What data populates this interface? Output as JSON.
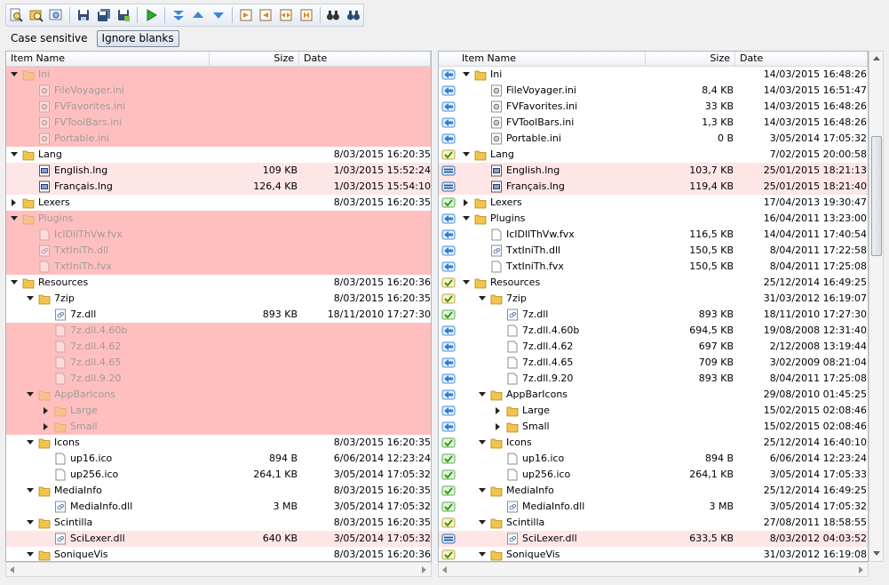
{
  "toolbar": {
    "icons": [
      "search-file-icon",
      "search-folder-icon",
      "find-icon",
      "save-icon",
      "save-all-icon",
      "save-as-icon",
      "run-icon",
      "expand-all-icon",
      "prev-diff-icon",
      "next-diff-icon",
      "copy-right-icon",
      "copy-left-icon",
      "swap-icon",
      "merge-icon",
      "find-binoculars-icon",
      "find-next-binoculars-icon"
    ]
  },
  "options": {
    "case_sensitive": "Case sensitive",
    "ignore_blanks": "Ignore blanks"
  },
  "columns": {
    "name": "Item Name",
    "size": "Size",
    "date": "Date"
  },
  "left": [
    {
      "lvl": 0,
      "tw": "open",
      "type": "folder",
      "name": "Ini",
      "size": "",
      "date": "",
      "bg": "diff",
      "missing": true
    },
    {
      "lvl": 1,
      "type": "ini",
      "name": "FileVoyager.ini",
      "size": "",
      "date": "",
      "bg": "diff",
      "missing": true
    },
    {
      "lvl": 1,
      "type": "ini",
      "name": "FVFavorites.ini",
      "size": "",
      "date": "",
      "bg": "diff",
      "missing": true
    },
    {
      "lvl": 1,
      "type": "ini",
      "name": "FVToolBars.ini",
      "size": "",
      "date": "",
      "bg": "diff",
      "missing": true
    },
    {
      "lvl": 1,
      "type": "ini",
      "name": "Portable.ini",
      "size": "",
      "date": "",
      "bg": "diff",
      "missing": true
    },
    {
      "lvl": 0,
      "tw": "open",
      "type": "folder",
      "name": "Lang",
      "size": "",
      "date": "8/03/2015 16:20:35"
    },
    {
      "lvl": 1,
      "type": "lng",
      "name": "English.lng",
      "size": "109 KB",
      "date": "1/03/2015 15:52:24",
      "bg": "light"
    },
    {
      "lvl": 1,
      "type": "lng",
      "name": "Français.lng",
      "size": "126,4 KB",
      "date": "1/03/2015 15:54:10",
      "bg": "light"
    },
    {
      "lvl": 0,
      "tw": "closed",
      "type": "folder",
      "name": "Lexers",
      "size": "",
      "date": "8/03/2015 16:20:35"
    },
    {
      "lvl": 0,
      "tw": "open",
      "type": "folder",
      "name": "Plugins",
      "size": "",
      "date": "",
      "bg": "diff",
      "missing": true
    },
    {
      "lvl": 1,
      "type": "file",
      "name": "IcIDllThVw.fvx",
      "size": "",
      "date": "",
      "bg": "diff",
      "missing": true
    },
    {
      "lvl": 1,
      "type": "dll",
      "name": "TxtIniTh.dll",
      "size": "",
      "date": "",
      "bg": "diff",
      "missing": true
    },
    {
      "lvl": 1,
      "type": "file",
      "name": "TxtIniTh.fvx",
      "size": "",
      "date": "",
      "bg": "diff",
      "missing": true
    },
    {
      "lvl": 0,
      "tw": "open",
      "type": "folder",
      "name": "Resources",
      "size": "",
      "date": "8/03/2015 16:20:36"
    },
    {
      "lvl": 1,
      "tw": "open",
      "type": "folder",
      "name": "7zip",
      "size": "",
      "date": "8/03/2015 16:20:35"
    },
    {
      "lvl": 2,
      "type": "dll",
      "name": "7z.dll",
      "size": "893 KB",
      "date": "18/11/2010 17:27:30"
    },
    {
      "lvl": 2,
      "type": "file",
      "name": "7z.dll.4.60b",
      "size": "",
      "date": "",
      "bg": "diff",
      "missing": true
    },
    {
      "lvl": 2,
      "type": "file",
      "name": "7z.dll.4.62",
      "size": "",
      "date": "",
      "bg": "diff",
      "missing": true
    },
    {
      "lvl": 2,
      "type": "file",
      "name": "7z.dll.4.65",
      "size": "",
      "date": "",
      "bg": "diff",
      "missing": true
    },
    {
      "lvl": 2,
      "type": "file",
      "name": "7z.dll.9.20",
      "size": "",
      "date": "",
      "bg": "diff",
      "missing": true
    },
    {
      "lvl": 1,
      "tw": "open",
      "type": "folder",
      "name": "AppBarIcons",
      "size": "",
      "date": "",
      "bg": "diff",
      "missing": true
    },
    {
      "lvl": 2,
      "tw": "closed",
      "type": "folder",
      "name": "Large",
      "size": "",
      "date": "",
      "bg": "diff",
      "missing": true
    },
    {
      "lvl": 2,
      "tw": "closed",
      "type": "folder",
      "name": "Small",
      "size": "",
      "date": "",
      "bg": "diff",
      "missing": true
    },
    {
      "lvl": 1,
      "tw": "open",
      "type": "folder",
      "name": "Icons",
      "size": "",
      "date": "8/03/2015 16:20:35"
    },
    {
      "lvl": 2,
      "type": "file",
      "name": "up16.ico",
      "size": "894 B",
      "date": "6/06/2014 12:23:24"
    },
    {
      "lvl": 2,
      "type": "file",
      "name": "up256.ico",
      "size": "264,1 KB",
      "date": "3/05/2014 17:05:32"
    },
    {
      "lvl": 1,
      "tw": "open",
      "type": "folder",
      "name": "MediaInfo",
      "size": "",
      "date": "8/03/2015 16:20:35"
    },
    {
      "lvl": 2,
      "type": "dll",
      "name": "MediaInfo.dll",
      "size": "3 MB",
      "date": "3/05/2014 17:05:32"
    },
    {
      "lvl": 1,
      "tw": "open",
      "type": "folder",
      "name": "Scintilla",
      "size": "",
      "date": "8/03/2015 16:20:35"
    },
    {
      "lvl": 2,
      "type": "dll",
      "name": "SciLexer.dll",
      "size": "640 KB",
      "date": "3/05/2014 17:05:32",
      "bg": "light"
    },
    {
      "lvl": 1,
      "tw": "open",
      "type": "folder",
      "name": "SoniqueVis",
      "size": "",
      "date": "8/03/2015 16:20:36"
    }
  ],
  "right": [
    {
      "st": "left",
      "lvl": 0,
      "tw": "open",
      "type": "folder",
      "name": "Ini",
      "size": "",
      "date": "14/03/2015 16:48:26"
    },
    {
      "st": "left",
      "lvl": 1,
      "type": "ini",
      "name": "FileVoyager.ini",
      "size": "8,4 KB",
      "date": "14/03/2015 16:51:47"
    },
    {
      "st": "left",
      "lvl": 1,
      "type": "ini",
      "name": "FVFavorites.ini",
      "size": "33 KB",
      "date": "14/03/2015 16:48:26"
    },
    {
      "st": "left",
      "lvl": 1,
      "type": "ini",
      "name": "FVToolBars.ini",
      "size": "1,3 KB",
      "date": "14/03/2015 16:48:26"
    },
    {
      "st": "left",
      "lvl": 1,
      "type": "ini",
      "name": "Portable.ini",
      "size": "0 B",
      "date": "3/05/2014 17:05:32"
    },
    {
      "st": "mixed",
      "lvl": 0,
      "tw": "open",
      "type": "folder",
      "name": "Lang",
      "size": "",
      "date": "7/02/2015 20:00:58"
    },
    {
      "st": "diff",
      "lvl": 1,
      "type": "lng",
      "name": "English.lng",
      "size": "103,7 KB",
      "date": "25/01/2015 18:21:13",
      "bg": "light"
    },
    {
      "st": "diff",
      "lvl": 1,
      "type": "lng",
      "name": "Français.lng",
      "size": "119,4 KB",
      "date": "25/01/2015 18:21:40",
      "bg": "light"
    },
    {
      "st": "ok",
      "lvl": 0,
      "tw": "closed",
      "type": "folder",
      "name": "Lexers",
      "size": "",
      "date": "17/04/2013 19:30:47"
    },
    {
      "st": "left",
      "lvl": 0,
      "tw": "open",
      "type": "folder",
      "name": "Plugins",
      "size": "",
      "date": "16/04/2011 13:23:00"
    },
    {
      "st": "left",
      "lvl": 1,
      "type": "file",
      "name": "IcIDllThVw.fvx",
      "size": "116,5 KB",
      "date": "14/04/2011 17:40:54"
    },
    {
      "st": "left",
      "lvl": 1,
      "type": "dll",
      "name": "TxtIniTh.dll",
      "size": "150,5 KB",
      "date": "8/04/2011 17:22:58"
    },
    {
      "st": "left",
      "lvl": 1,
      "type": "file",
      "name": "TxtIniTh.fvx",
      "size": "150,5 KB",
      "date": "8/04/2011 17:25:08"
    },
    {
      "st": "mixed",
      "lvl": 0,
      "tw": "open",
      "type": "folder",
      "name": "Resources",
      "size": "",
      "date": "25/12/2014 16:49:25"
    },
    {
      "st": "mixed",
      "lvl": 1,
      "tw": "open",
      "type": "folder",
      "name": "7zip",
      "size": "",
      "date": "31/03/2012 16:19:07"
    },
    {
      "st": "ok",
      "lvl": 2,
      "type": "dll",
      "name": "7z.dll",
      "size": "893 KB",
      "date": "18/11/2010 17:27:30"
    },
    {
      "st": "left",
      "lvl": 2,
      "type": "file",
      "name": "7z.dll.4.60b",
      "size": "694,5 KB",
      "date": "19/08/2008 12:31:40"
    },
    {
      "st": "left",
      "lvl": 2,
      "type": "file",
      "name": "7z.dll.4.62",
      "size": "697 KB",
      "date": "2/12/2008 13:19:44"
    },
    {
      "st": "left",
      "lvl": 2,
      "type": "file",
      "name": "7z.dll.4.65",
      "size": "709 KB",
      "date": "3/02/2009 08:21:04"
    },
    {
      "st": "left",
      "lvl": 2,
      "type": "file",
      "name": "7z.dll.9.20",
      "size": "893 KB",
      "date": "8/04/2011 17:25:08"
    },
    {
      "st": "left",
      "lvl": 1,
      "tw": "open",
      "type": "folder",
      "name": "AppBarIcons",
      "size": "",
      "date": "29/08/2010 01:45:25"
    },
    {
      "st": "left",
      "lvl": 2,
      "tw": "closed",
      "type": "folder",
      "name": "Large",
      "size": "",
      "date": "15/02/2015 02:08:46"
    },
    {
      "st": "left",
      "lvl": 2,
      "tw": "closed",
      "type": "folder",
      "name": "Small",
      "size": "",
      "date": "15/02/2015 02:08:46"
    },
    {
      "st": "ok",
      "lvl": 1,
      "tw": "open",
      "type": "folder",
      "name": "Icons",
      "size": "",
      "date": "25/12/2014 16:40:10"
    },
    {
      "st": "ok",
      "lvl": 2,
      "type": "file",
      "name": "up16.ico",
      "size": "894 B",
      "date": "6/06/2014 12:23:24"
    },
    {
      "st": "ok",
      "lvl": 2,
      "type": "file",
      "name": "up256.ico",
      "size": "264,1 KB",
      "date": "3/05/2014 17:05:33"
    },
    {
      "st": "ok",
      "lvl": 1,
      "tw": "open",
      "type": "folder",
      "name": "MediaInfo",
      "size": "",
      "date": "25/12/2014 16:49:25"
    },
    {
      "st": "ok",
      "lvl": 2,
      "type": "dll",
      "name": "MediaInfo.dll",
      "size": "3 MB",
      "date": "3/05/2014 17:05:32"
    },
    {
      "st": "mixed",
      "lvl": 1,
      "tw": "open",
      "type": "folder",
      "name": "Scintilla",
      "size": "",
      "date": "27/08/2011 18:58:55"
    },
    {
      "st": "diff",
      "lvl": 2,
      "type": "dll",
      "name": "SciLexer.dll",
      "size": "633,5 KB",
      "date": "8/03/2012 04:03:52",
      "bg": "light"
    },
    {
      "st": "mixed",
      "lvl": 1,
      "tw": "open",
      "type": "folder",
      "name": "SoniqueVis",
      "size": "",
      "date": "31/03/2012 16:19:08"
    }
  ]
}
